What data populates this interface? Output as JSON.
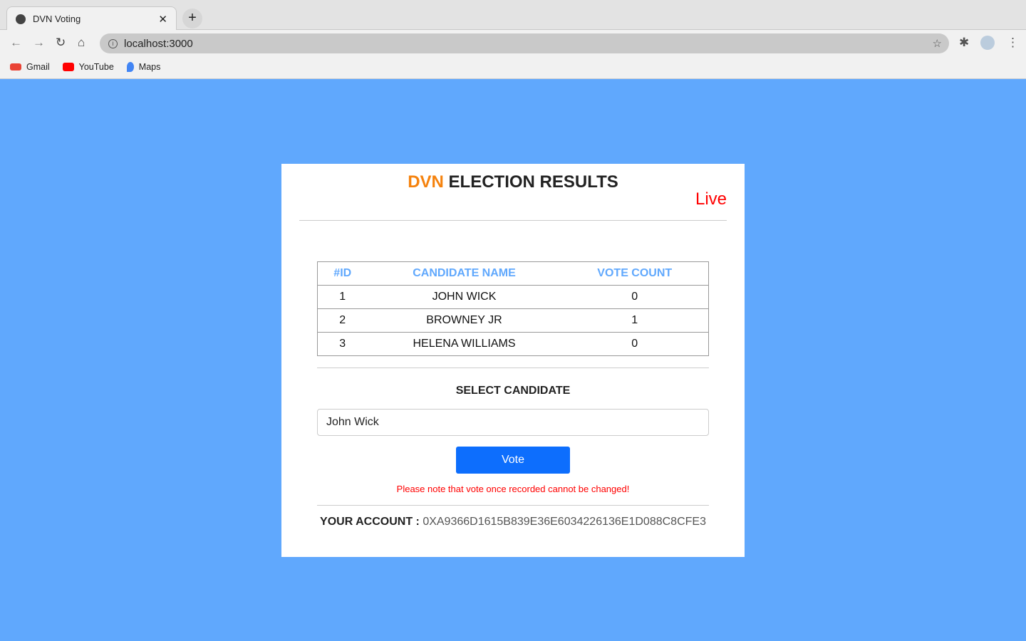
{
  "browser": {
    "tab_title": "DVN Voting",
    "url": "localhost:3000",
    "bookmarks": [
      {
        "label": "Gmail"
      },
      {
        "label": "YouTube"
      },
      {
        "label": "Maps"
      }
    ]
  },
  "card": {
    "title_brand": "DVN",
    "title_rest": "ELECTION RESULTS",
    "status": "Live",
    "table": {
      "headers": [
        "#ID",
        "CANDIDATE NAME",
        "VOTE COUNT"
      ],
      "rows": [
        [
          "1",
          "JOHN WICK",
          "0"
        ],
        [
          "2",
          "BROWNEY JR",
          "1"
        ],
        [
          "3",
          "HELENA WILLIAMS",
          "0"
        ]
      ]
    },
    "select_label": "SELECT CANDIDATE",
    "selected": "John Wick",
    "vote_label": "Vote",
    "note": "Please note that vote once recorded cannot be changed!",
    "account_label": "YOUR ACCOUNT :",
    "account_value": "0XA9366D1615B839E36E6034226136E1D088C8CFE3"
  },
  "colors": {
    "background": "#60a8fd",
    "brand": "#f5820d",
    "button": "#0d6efd",
    "live": "#ff0000"
  }
}
